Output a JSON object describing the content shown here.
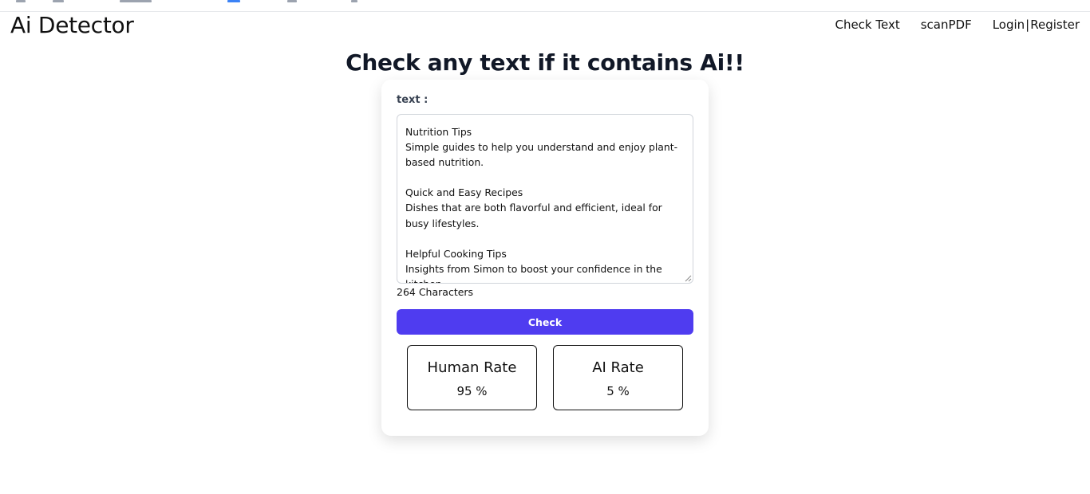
{
  "header": {
    "brand": "Ai Detector",
    "nav": {
      "check_text": "Check Text",
      "scan_pdf": "scanPDF",
      "login": "Login",
      "separator": "|",
      "register": "Register"
    }
  },
  "main": {
    "headline": "Check any text if it contains Ai!!",
    "form": {
      "label": "text :",
      "text_value": "Nutrition Tips\nSimple guides to help you understand and enjoy plant-based nutrition.\n\nQuick and Easy Recipes\nDishes that are both flavorful and efficient, ideal for busy lifestyles.\n\nHelpful Cooking Tips\nInsights from Simon to boost your confidence in the kitchen.",
      "char_count": "264 Characters",
      "check_label": "Check"
    },
    "results": {
      "human": {
        "title": "Human Rate",
        "value": "95 %"
      },
      "ai": {
        "title": "AI Rate",
        "value": "5 %"
      }
    }
  },
  "colors": {
    "accent": "#4f3cf0",
    "headline": "#111827",
    "label": "#374151"
  }
}
